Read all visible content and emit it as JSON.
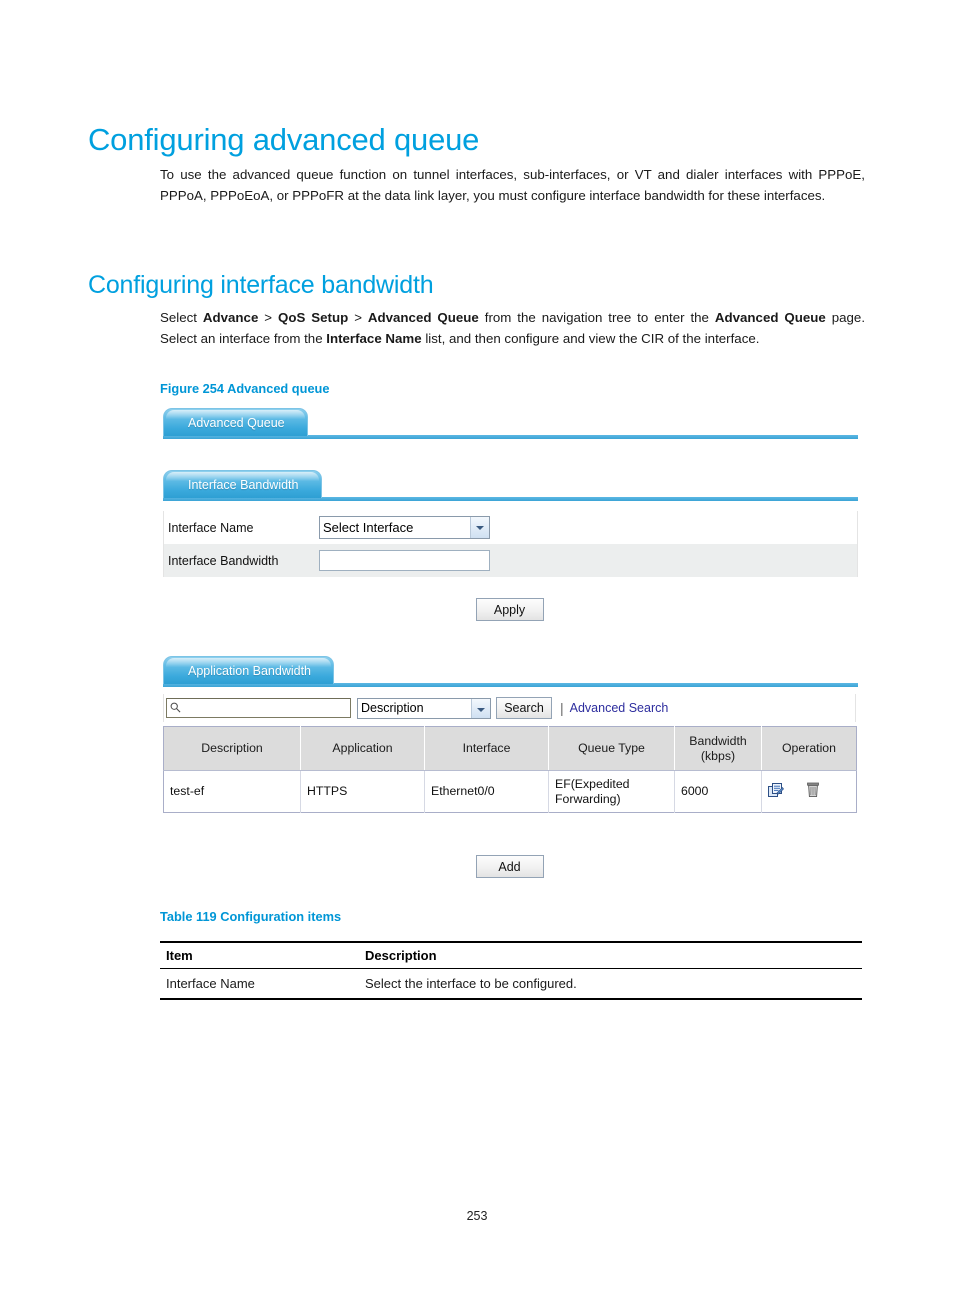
{
  "document": {
    "heading1": "Configuring advanced queue",
    "paragraph1_html": "To use the advanced queue function on tunnel interfaces, sub-interfaces, or VT and dialer interfaces with PPPoE, PPPoA, PPPoEoA, or PPPoFR at the data link layer, you must configure interface bandwidth for these interfaces.",
    "heading2": "Configuring interface bandwidth",
    "paragraph2_html": "Select <b>Advance</b> &gt; <b>QoS Setup</b> &gt; <b>Advanced Queue</b> from the navigation tree to enter the <b>Advanced Queue</b> page. Select an interface from the <b>Interface Name</b> list, and then configure and view the CIR of the interface.",
    "figure_caption": "Figure 254 Advanced queue",
    "table_caption": "Table 119 Configuration items",
    "page_number": "253",
    "accent_color": "#0096d6"
  },
  "screenshot": {
    "tabs": {
      "advanced_queue": "Advanced Queue",
      "interface_bandwidth": "Interface Bandwidth",
      "application_bandwidth": "Application Bandwidth"
    },
    "interface_bandwidth_form": {
      "rows": [
        {
          "label": "Interface Name",
          "control": "select",
          "value": "Select Interface"
        },
        {
          "label": "Interface Bandwidth",
          "control": "text",
          "value": "",
          "placeholder": ""
        }
      ],
      "apply_label": "Apply"
    },
    "search": {
      "query": "",
      "placeholder": "",
      "field_selected": "Description",
      "search_button": "Search",
      "advanced_search_link": "Advanced Search",
      "separator": "|",
      "link_color": "#2d2d9e"
    },
    "application_table": {
      "headers": [
        "Description",
        "Application",
        "Interface",
        "Queue Type",
        "Bandwidth (kbps)",
        "Operation"
      ],
      "header_bandwidth_line1": "Bandwidth",
      "header_bandwidth_line2": "(kbps)",
      "rows": [
        {
          "description": "test-ef",
          "application": "HTTPS",
          "interface": "Ethernet0/0",
          "queue_type": "EF(Expedited Forwarding)",
          "bandwidth": "6000",
          "operations": [
            "edit-icon",
            "delete-icon"
          ]
        }
      ]
    },
    "add_label": "Add"
  },
  "config_table": {
    "headers": [
      "Item",
      "Description"
    ],
    "rows": [
      {
        "item": "Interface Name",
        "description": "Select the interface to be configured."
      }
    ]
  }
}
